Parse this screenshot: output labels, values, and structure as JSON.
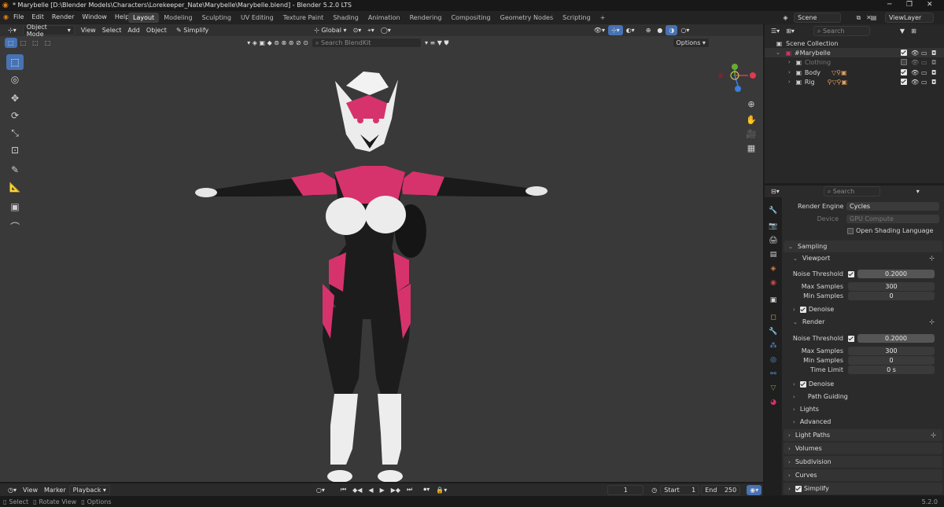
{
  "title_bar": {
    "title": "* Marybelle [D:\\Blender Models\\Characters\\Lorekeeper_Nate\\Marybelle\\Marybelle.blend] - Blender 5.2.0 LTS"
  },
  "menu": {
    "items": [
      "File",
      "Edit",
      "Render",
      "Window",
      "Help"
    ]
  },
  "workspaces": [
    "Layout",
    "Modeling",
    "Sculpting",
    "UV Editing",
    "Texture Paint",
    "Shading",
    "Animation",
    "Rendering",
    "Compositing",
    "Geometry Nodes",
    "Scripting"
  ],
  "scene": {
    "name": "Scene",
    "view_layer": "ViewLayer"
  },
  "viewport_header": {
    "mode": "Object Mode",
    "menus": [
      "View",
      "Select",
      "Add",
      "Object"
    ],
    "simplify": "Simplify",
    "orientation": "Global",
    "options": "Options",
    "search_placeholder": "Search BlendKit"
  },
  "outliner": {
    "search_placeholder": "Search",
    "root": "Scene Collection",
    "collection": "#Marybelle",
    "items": [
      {
        "name": "Clothing"
      },
      {
        "name": "Body"
      },
      {
        "name": "Rig"
      }
    ]
  },
  "properties": {
    "search_placeholder": "Search",
    "render_engine_label": "Render Engine",
    "render_engine": "Cycles",
    "device_label": "Device",
    "device": "GPU Compute",
    "osl": "Open Shading Language",
    "sampling": "Sampling",
    "viewport": "Viewport",
    "noise_threshold_label": "Noise Threshold",
    "vp_noise": "0.2000",
    "max_samples_label": "Max Samples",
    "vp_max": "300",
    "min_samples_label": "Min Samples",
    "vp_min": "0",
    "denoise": "Denoise",
    "render": "Render",
    "r_noise": "0.2000",
    "r_max": "300",
    "r_min": "0",
    "time_limit_label": "Time Limit",
    "time_limit": "0 s",
    "path_guiding": "Path Guiding",
    "lights": "Lights",
    "advanced": "Advanced",
    "light_paths": "Light Paths",
    "volumes": "Volumes",
    "subdivision": "Subdivision",
    "curves": "Curves",
    "simplify": "Simplify"
  },
  "timeline": {
    "menus": [
      "View",
      "Marker"
    ],
    "playback": "Playback",
    "frame": "1",
    "start_label": "Start",
    "start": "1",
    "end_label": "End",
    "end": "250"
  },
  "status": {
    "select": "Select",
    "rotate": "Rotate View",
    "options": "Options",
    "version": "5.2.0"
  }
}
